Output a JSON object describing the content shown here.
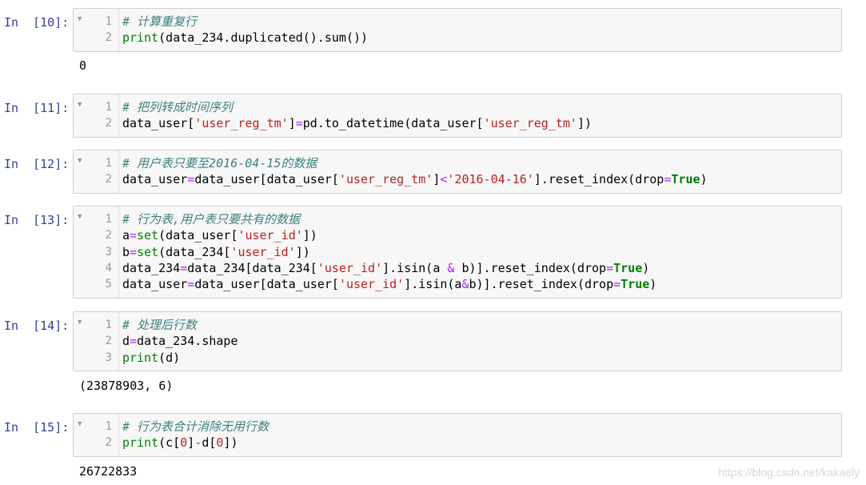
{
  "cells": [
    {
      "prompt": "In  [10]:",
      "lines": [
        [
          {
            "t": "# 计算重复行",
            "c": "cm"
          }
        ],
        [
          {
            "t": "print",
            "c": "bi"
          },
          {
            "t": "(data_234.duplicated().sum())",
            "c": ""
          }
        ]
      ],
      "output": "0"
    },
    {
      "prompt": "In  [11]:",
      "lines": [
        [
          {
            "t": "# 把列转成时间序列",
            "c": "cm"
          }
        ],
        [
          {
            "t": "data_user[",
            "c": ""
          },
          {
            "t": "'user_reg_tm'",
            "c": "st"
          },
          {
            "t": "]",
            "c": ""
          },
          {
            "t": "=",
            "c": "op"
          },
          {
            "t": "pd.to_datetime(data_user[",
            "c": ""
          },
          {
            "t": "'user_reg_tm'",
            "c": "st"
          },
          {
            "t": "])",
            "c": ""
          }
        ]
      ],
      "output": ""
    },
    {
      "prompt": "In  [12]:",
      "lines": [
        [
          {
            "t": "# 用户表只要至2016-04-15的数据",
            "c": "cm"
          }
        ],
        [
          {
            "t": "data_user",
            "c": ""
          },
          {
            "t": "=",
            "c": "op"
          },
          {
            "t": "data_user[data_user[",
            "c": ""
          },
          {
            "t": "'user_reg_tm'",
            "c": "st"
          },
          {
            "t": "]",
            "c": ""
          },
          {
            "t": "<",
            "c": "op"
          },
          {
            "t": "'2016-04-16'",
            "c": "st"
          },
          {
            "t": "].reset_index(drop",
            "c": ""
          },
          {
            "t": "=",
            "c": "op"
          },
          {
            "t": "True",
            "c": "kw"
          },
          {
            "t": ")",
            "c": ""
          }
        ]
      ],
      "output": ""
    },
    {
      "prompt": "In  [13]:",
      "lines": [
        [
          {
            "t": "# 行为表,用户表只要共有的数据",
            "c": "cm"
          }
        ],
        [
          {
            "t": "a",
            "c": ""
          },
          {
            "t": "=",
            "c": "op"
          },
          {
            "t": "set",
            "c": "bi"
          },
          {
            "t": "(data_user[",
            "c": ""
          },
          {
            "t": "'user_id'",
            "c": "st"
          },
          {
            "t": "])",
            "c": ""
          }
        ],
        [
          {
            "t": "b",
            "c": ""
          },
          {
            "t": "=",
            "c": "op"
          },
          {
            "t": "set",
            "c": "bi"
          },
          {
            "t": "(data_234[",
            "c": ""
          },
          {
            "t": "'user_id'",
            "c": "st"
          },
          {
            "t": "])",
            "c": ""
          }
        ],
        [
          {
            "t": "data_234",
            "c": ""
          },
          {
            "t": "=",
            "c": "op"
          },
          {
            "t": "data_234[data_234[",
            "c": ""
          },
          {
            "t": "'user_id'",
            "c": "st"
          },
          {
            "t": "].isin(a ",
            "c": ""
          },
          {
            "t": "&",
            "c": "op"
          },
          {
            "t": " b)].reset_index(drop",
            "c": ""
          },
          {
            "t": "=",
            "c": "op"
          },
          {
            "t": "True",
            "c": "kw"
          },
          {
            "t": ")",
            "c": ""
          }
        ],
        [
          {
            "t": "data_user",
            "c": ""
          },
          {
            "t": "=",
            "c": "op"
          },
          {
            "t": "data_user[data_user[",
            "c": ""
          },
          {
            "t": "'user_id'",
            "c": "st"
          },
          {
            "t": "].isin(a",
            "c": ""
          },
          {
            "t": "&",
            "c": "op"
          },
          {
            "t": "b)].reset_index(drop",
            "c": ""
          },
          {
            "t": "=",
            "c": "op"
          },
          {
            "t": "True",
            "c": "kw"
          },
          {
            "t": ")",
            "c": ""
          }
        ]
      ],
      "output": ""
    },
    {
      "prompt": "In  [14]:",
      "lines": [
        [
          {
            "t": "# 处理后行数",
            "c": "cm"
          }
        ],
        [
          {
            "t": "d",
            "c": ""
          },
          {
            "t": "=",
            "c": "op"
          },
          {
            "t": "data_234.shape",
            "c": ""
          }
        ],
        [
          {
            "t": "print",
            "c": "bi"
          },
          {
            "t": "(d)",
            "c": ""
          }
        ]
      ],
      "output": "(23878903, 6)"
    },
    {
      "prompt": "In  [15]:",
      "lines": [
        [
          {
            "t": "# 行为表合计消除无用行数",
            "c": "cm"
          }
        ],
        [
          {
            "t": "print",
            "c": "bi"
          },
          {
            "t": "(c[",
            "c": ""
          },
          {
            "t": "0",
            "c": "st"
          },
          {
            "t": "]",
            "c": ""
          },
          {
            "t": "-",
            "c": "op"
          },
          {
            "t": "d[",
            "c": ""
          },
          {
            "t": "0",
            "c": "st"
          },
          {
            "t": "])",
            "c": ""
          }
        ]
      ],
      "output": "26722833"
    }
  ],
  "watermark": "https://blog.csdn.net/kakaely",
  "fold_icon": "▼"
}
